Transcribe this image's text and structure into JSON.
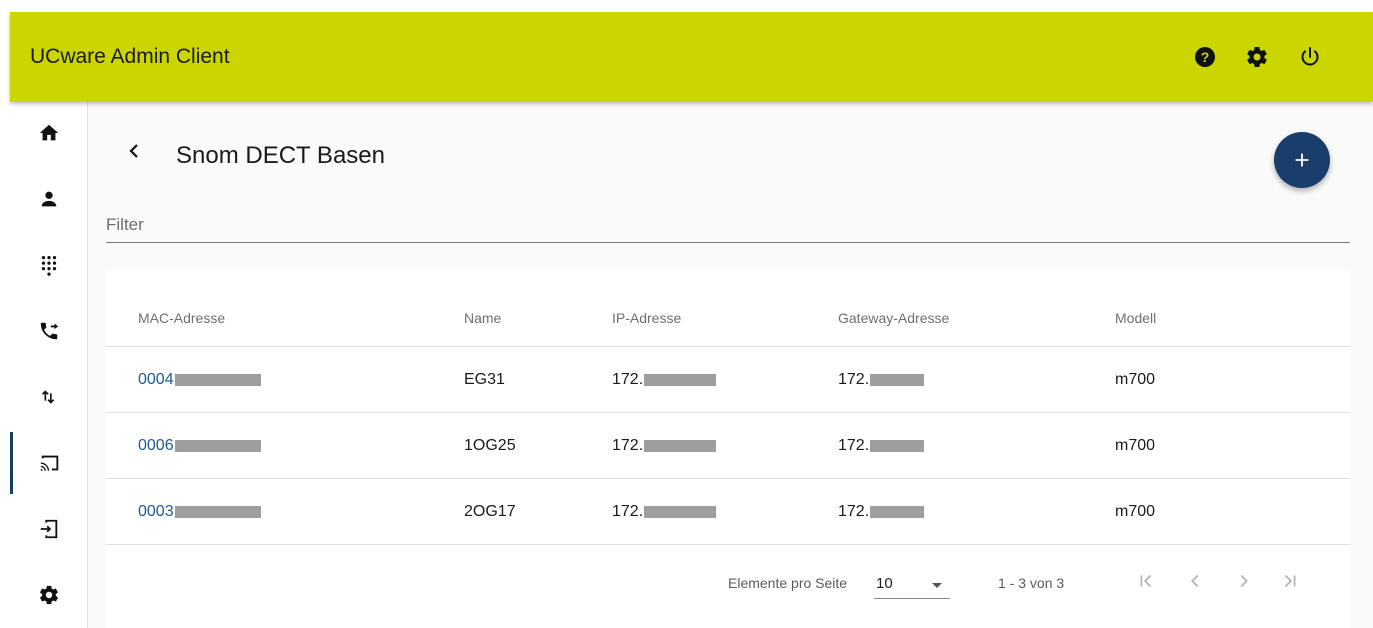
{
  "header": {
    "title": "UCware Admin Client",
    "icons": [
      "help-icon",
      "settings-icon",
      "power-icon"
    ]
  },
  "sidebar": {
    "items": [
      {
        "name": "home-icon"
      },
      {
        "name": "user-icon"
      },
      {
        "name": "dialpad-icon"
      },
      {
        "name": "call-forward-icon"
      },
      {
        "name": "transfer-arrows-icon"
      },
      {
        "name": "cast-icon",
        "active": true
      },
      {
        "name": "login-icon"
      },
      {
        "name": "settings-icon"
      }
    ]
  },
  "page": {
    "title": "Snom DECT Basen",
    "filter_placeholder": "Filter"
  },
  "table": {
    "headers": {
      "mac": "MAC-Adresse",
      "name": "Name",
      "ip": "IP-Adresse",
      "gateway": "Gateway-Adresse",
      "model": "Modell"
    },
    "rows": [
      {
        "mac": "0004",
        "name": "EG31",
        "ip": "172.",
        "gateway": "172.",
        "model": "m700"
      },
      {
        "mac": "0006",
        "name": "1OG25",
        "ip": "172.",
        "gateway": "172.",
        "model": "m700"
      },
      {
        "mac": "0003",
        "name": "2OG17",
        "ip": "172.",
        "gateway": "172.",
        "model": "m700"
      }
    ]
  },
  "paginator": {
    "label": "Elemente pro Seite",
    "page_size": "10",
    "range": "1 - 3 von 3"
  },
  "colors": {
    "topbar": "#cbd600",
    "primary": "#1a3e6b",
    "link": "#1d5a96"
  }
}
